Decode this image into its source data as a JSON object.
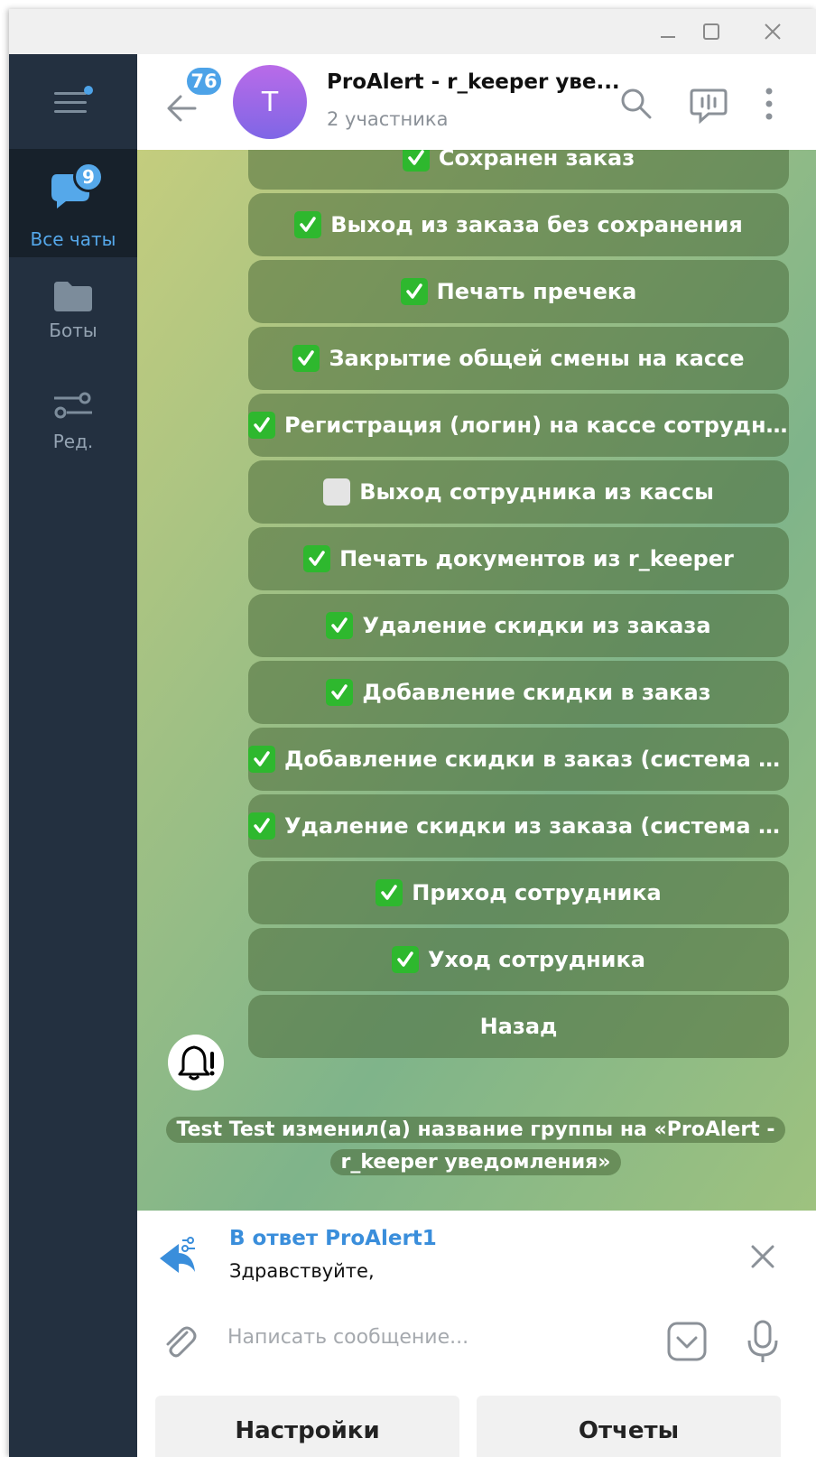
{
  "window": {
    "controls": [
      "minimize-icon",
      "maximize-icon",
      "close-icon"
    ]
  },
  "sidebar": {
    "menu_icon": "hamburger-menu-icon",
    "folders": [
      {
        "label": "Все чаты",
        "badge": "9",
        "icon": "chats-icon",
        "active": true
      },
      {
        "label": "Боты",
        "icon": "folder-icon",
        "active": false
      },
      {
        "label": "Ред.",
        "icon": "edit-filters-icon",
        "active": false
      }
    ]
  },
  "header": {
    "back_badge": "76",
    "avatar_letter": "T",
    "title": "ProAlert - r_keeper уве...",
    "subtitle": "2 участника",
    "icons": [
      "search-icon",
      "live-chat-icon",
      "more-icon"
    ]
  },
  "keyboard": [
    {
      "label": "Сохранен заказ",
      "checked": true
    },
    {
      "label": "Выход из заказа без сохранения",
      "checked": true
    },
    {
      "label": "Печать пречека",
      "checked": true
    },
    {
      "label": "Закрытие общей смены на кассе",
      "checked": true
    },
    {
      "label": "Регистрация (логин) на кассе сотрудн...",
      "checked": true
    },
    {
      "label": "Выход сотрудника из кассы",
      "checked": false
    },
    {
      "label": "Печать документов из r_keeper",
      "checked": true
    },
    {
      "label": "Удаление скидки из заказа",
      "checked": true
    },
    {
      "label": "Добавление скидки в заказ",
      "checked": true
    },
    {
      "label": "Добавление скидки в заказ (система л...",
      "checked": true
    },
    {
      "label": "Удаление скидки из заказа (система л...",
      "checked": true
    },
    {
      "label": "Приход сотрудника",
      "checked": true
    },
    {
      "label": "Уход сотрудника",
      "checked": true
    },
    {
      "label": "Назад",
      "checked": null
    }
  ],
  "service_message": "Test Test изменил(а) название группы на «ProAlert - r_keeper уведомления»",
  "reply": {
    "title": "В ответ ProAlert1",
    "text": "Здравствуйте,"
  },
  "composer": {
    "placeholder": "Написать сообщение..."
  },
  "bot_buttons": [
    "Настройки",
    "Отчеты"
  ],
  "colors": {
    "accent": "#4da3e8",
    "sidebar": "#233040",
    "check": "#2eb82e"
  }
}
